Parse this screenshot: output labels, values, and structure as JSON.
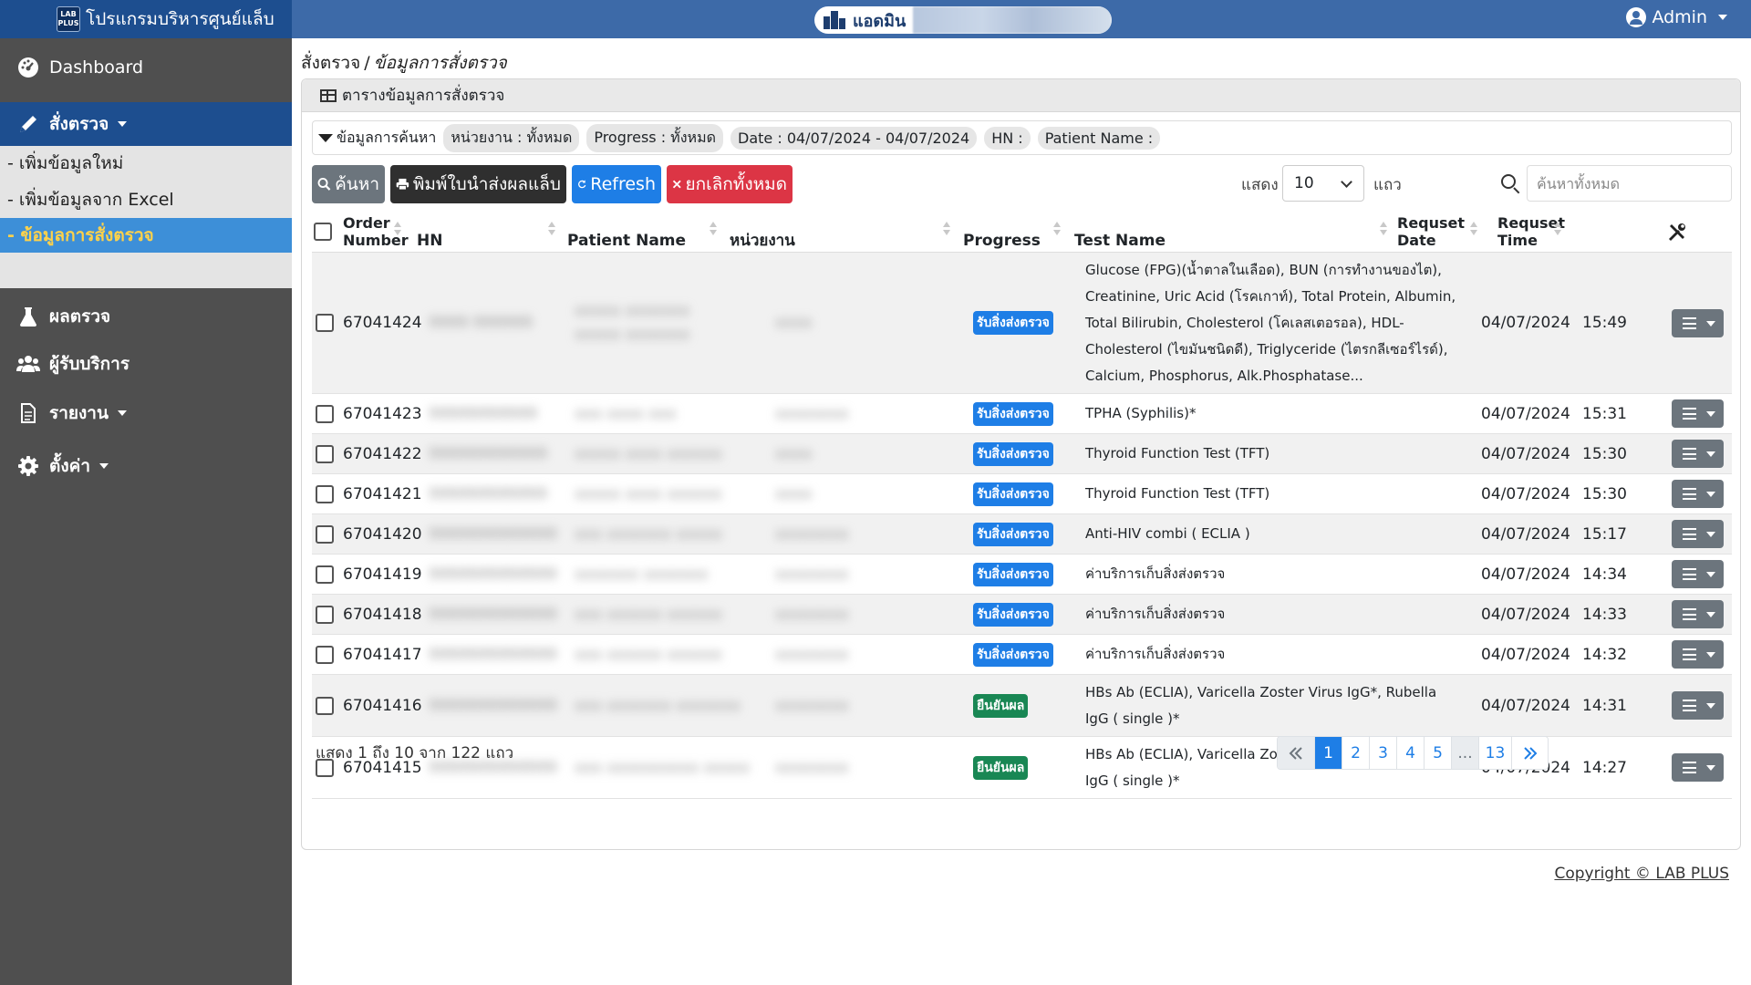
{
  "header": {
    "brand": "โปรแกรมบริหารศูนย์แล็บ",
    "brand_logo": "LAB PLUS",
    "center_label": "แอดมิน",
    "user": "Admin"
  },
  "sidebar": {
    "items": [
      {
        "label": "Dashboard",
        "icon": "dashboard-icon"
      },
      {
        "label": "สั่งตรวจ",
        "icon": "pencil-icon"
      },
      {
        "label": "ผลตรวจ",
        "icon": "flask-icon"
      },
      {
        "label": "ผู้รับบริการ",
        "icon": "users-icon"
      },
      {
        "label": "รายงาน",
        "icon": "file-icon"
      },
      {
        "label": "ตั้งค่า",
        "icon": "gear-icon"
      }
    ],
    "subitems": [
      {
        "label": "- เพิ่มข้อมูลใหม่"
      },
      {
        "label": "- เพิ่มข้อมูลจาก Excel"
      },
      {
        "label": "- ข้อมูลการสั่งตรวจ"
      }
    ]
  },
  "breadcrumb": {
    "root": "สั่งตรวจ",
    "sep": "/",
    "current": "ข้อมูลการสั่งตรวจ"
  },
  "card": {
    "title": "ตารางข้อมูลการสั่งตรวจ"
  },
  "filters": {
    "title": "ข้อมูลการค้นหา",
    "chips": [
      "หน่วยงาน : ทั้งหมด",
      "Progress : ทั้งหมด",
      "Date : 04/07/2024 - 04/07/2024",
      "HN :",
      "Patient Name :"
    ]
  },
  "toolbar": {
    "search": "ค้นหา",
    "print": "พิมพ์ใบนำส่งผลแล็บ",
    "refresh": "Refresh",
    "cancel_all": "ยกเลิกทั้งหมด",
    "show_label": "แสดง",
    "page_size": "10",
    "rows_label": "แถว",
    "search_placeholder": "ค้นหาทั้งหมด"
  },
  "table": {
    "headers": {
      "order_l1": "Order",
      "order_l2": "Number",
      "hn": "HN",
      "patient": "Patient Name",
      "unit": "หน่วยงาน",
      "progress": "Progress",
      "test": "Test Name",
      "date_l1": "Requset",
      "date_l2": "Date",
      "time_l1": "Requset",
      "time_l2": "Time"
    },
    "rows": [
      {
        "order": "67041424",
        "progress": "รับสิ่งส่งตรวจ",
        "progress_color": "#1e7ee6",
        "test": "Glucose (FPG)(น้ำตาลในเลือด), BUN (การทำงานของไต), Creatinine, Uric Acid (โรคเกาท์), Total Protein, Albumin, Total Bilirubin, Cholesterol (โคเลสเตอรอล), HDL-Cholesterol (ไขมันชนิดดี), Triglyceride (ไตรกลีเซอร์ไรด์), Calcium, Phosphorus, Alk.Phosphatase...",
        "date": "04/07/2024",
        "time": "15:49"
      },
      {
        "order": "67041423",
        "progress": "รับสิ่งส่งตรวจ",
        "progress_color": "#1e7ee6",
        "test": "TPHA (Syphilis)*",
        "date": "04/07/2024",
        "time": "15:31"
      },
      {
        "order": "67041422",
        "progress": "รับสิ่งส่งตรวจ",
        "progress_color": "#1e7ee6",
        "test": "Thyroid Function Test (TFT)",
        "date": "04/07/2024",
        "time": "15:30"
      },
      {
        "order": "67041421",
        "progress": "รับสิ่งส่งตรวจ",
        "progress_color": "#1e7ee6",
        "test": "Thyroid Function Test (TFT)",
        "date": "04/07/2024",
        "time": "15:30"
      },
      {
        "order": "67041420",
        "progress": "รับสิ่งส่งตรวจ",
        "progress_color": "#1e7ee6",
        "test": "Anti-HIV combi ( ECLIA )",
        "date": "04/07/2024",
        "time": "15:17"
      },
      {
        "order": "67041419",
        "progress": "รับสิ่งส่งตรวจ",
        "progress_color": "#1e7ee6",
        "test": "ค่าบริการเก็บสิ่งส่งตรวจ",
        "date": "04/07/2024",
        "time": "14:34"
      },
      {
        "order": "67041418",
        "progress": "รับสิ่งส่งตรวจ",
        "progress_color": "#1e7ee6",
        "test": "ค่าบริการเก็บสิ่งส่งตรวจ",
        "date": "04/07/2024",
        "time": "14:33"
      },
      {
        "order": "67041417",
        "progress": "รับสิ่งส่งตรวจ",
        "progress_color": "#1e7ee6",
        "test": "ค่าบริการเก็บสิ่งส่งตรวจ",
        "date": "04/07/2024",
        "time": "14:32"
      },
      {
        "order": "67041416",
        "progress": "ยืนยันผล",
        "progress_color": "#198754",
        "test": "HBs Ab (ECLIA), Varicella Zoster Virus IgG*, Rubella IgG ( single )*",
        "date": "04/07/2024",
        "time": "14:31"
      },
      {
        "order": "67041415",
        "progress": "ยืนยันผล",
        "progress_color": "#198754",
        "test": "HBs Ab (ECLIA), Varicella Zoster Virus IgG*, Rubella IgG ( single )*",
        "date": "04/07/2024",
        "time": "14:27"
      }
    ]
  },
  "footer": {
    "info": "แสดง 1 ถึง 10 จาก 122 แถว",
    "pages": [
      "1",
      "2",
      "3",
      "4",
      "5",
      "...",
      "13"
    ],
    "active_page": "1",
    "copyright": "Copyright © LAB PLUS"
  }
}
